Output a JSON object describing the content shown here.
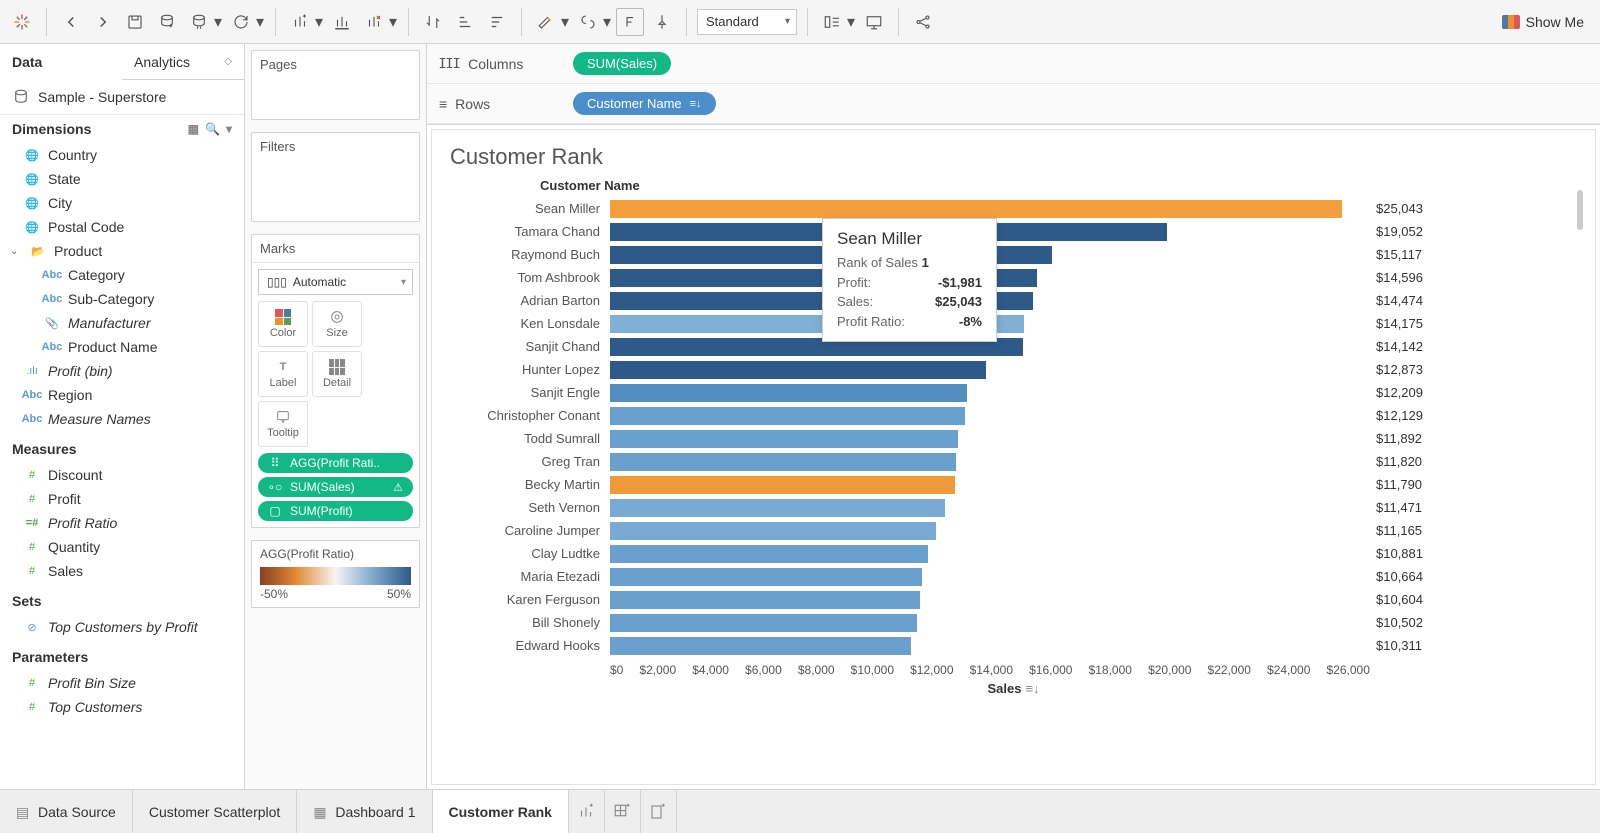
{
  "toolbar": {
    "fit_mode": "Standard",
    "show_me": "Show Me"
  },
  "side_tabs": {
    "data": "Data",
    "analytics": "Analytics"
  },
  "datasource": "Sample - Superstore",
  "sections": {
    "dimensions": "Dimensions",
    "measures": "Measures",
    "sets": "Sets",
    "parameters": "Parameters"
  },
  "dims": {
    "country": "Country",
    "state": "State",
    "city": "City",
    "postal": "Postal Code",
    "product": "Product",
    "category": "Category",
    "subcat": "Sub-Category",
    "manufacturer": "Manufacturer",
    "prodname": "Product Name",
    "profitbin": "Profit (bin)",
    "region": "Region",
    "measurenames": "Measure Names"
  },
  "meas": {
    "discount": "Discount",
    "profit": "Profit",
    "profitratio": "Profit Ratio",
    "quantity": "Quantity",
    "sales": "Sales"
  },
  "sets": {
    "topcust": "Top Customers by Profit"
  },
  "params": {
    "profitbinsize": "Profit Bin Size",
    "topcustomers": "Top Customers"
  },
  "shelves": {
    "pages": "Pages",
    "filters": "Filters",
    "marks": "Marks",
    "mark_type": "Automatic",
    "color": "Color",
    "size": "Size",
    "label": "Label",
    "detail": "Detail",
    "tooltip": "Tooltip",
    "pills": {
      "agg_profit_ratio": "AGG(Profit Rati..",
      "sum_sales": "SUM(Sales)",
      "sum_profit": "SUM(Profit)"
    }
  },
  "legend": {
    "title": "AGG(Profit Ratio)",
    "min": "-50%",
    "max": "50%"
  },
  "rc": {
    "columns": "Columns",
    "rows": "Rows",
    "col_pill": "SUM(Sales)",
    "row_pill": "Customer Name"
  },
  "viz": {
    "title": "Customer Rank",
    "field_header": "Customer Name",
    "axis_title": "Sales"
  },
  "chart_data": {
    "type": "bar",
    "xlabel": "Sales",
    "ylabel": "Customer Name",
    "xticks": [
      "$0",
      "$2,000",
      "$4,000",
      "$6,000",
      "$8,000",
      "$10,000",
      "$12,000",
      "$14,000",
      "$16,000",
      "$18,000",
      "$20,000",
      "$22,000",
      "$24,000",
      "$26,000"
    ],
    "xmax": 26000,
    "series": [
      {
        "name": "Sean Miller",
        "value": 25043,
        "label": "$25,043",
        "color": "#f3a03c"
      },
      {
        "name": "Tamara Chand",
        "value": 19052,
        "label": "$19,052",
        "color": "#2e5a8a"
      },
      {
        "name": "Raymond Buch",
        "value": 15117,
        "label": "$15,117",
        "color": "#2e5a8a"
      },
      {
        "name": "Tom Ashbrook",
        "value": 14596,
        "label": "$14,596",
        "color": "#2e5a8a"
      },
      {
        "name": "Adrian Barton",
        "value": 14474,
        "label": "$14,474",
        "color": "#2e5a8a"
      },
      {
        "name": "Ken Lonsdale",
        "value": 14175,
        "label": "$14,175",
        "color": "#82afd6"
      },
      {
        "name": "Sanjit Chand",
        "value": 14142,
        "label": "$14,142",
        "color": "#2e5a8a"
      },
      {
        "name": "Hunter Lopez",
        "value": 12873,
        "label": "$12,873",
        "color": "#2e5a8a"
      },
      {
        "name": "Sanjit Engle",
        "value": 12209,
        "label": "$12,209",
        "color": "#538ec0"
      },
      {
        "name": "Christopher Conant",
        "value": 12129,
        "label": "$12,129",
        "color": "#6aa0cd"
      },
      {
        "name": "Todd Sumrall",
        "value": 11892,
        "label": "$11,892",
        "color": "#6aa0cd"
      },
      {
        "name": "Greg Tran",
        "value": 11820,
        "label": "$11,820",
        "color": "#6aa0cd"
      },
      {
        "name": "Becky Martin",
        "value": 11790,
        "label": "$11,790",
        "color": "#ee9a3a"
      },
      {
        "name": "Seth Vernon",
        "value": 11471,
        "label": "$11,471",
        "color": "#79aad3"
      },
      {
        "name": "Caroline Jumper",
        "value": 11165,
        "label": "$11,165",
        "color": "#79aad3"
      },
      {
        "name": "Clay Ludtke",
        "value": 10881,
        "label": "$10,881",
        "color": "#6aa0cd"
      },
      {
        "name": "Maria Etezadi",
        "value": 10664,
        "label": "$10,664",
        "color": "#6aa0cd"
      },
      {
        "name": "Karen Ferguson",
        "value": 10604,
        "label": "$10,604",
        "color": "#6aa0cd"
      },
      {
        "name": "Bill Shonely",
        "value": 10502,
        "label": "$10,502",
        "color": "#6aa0cd"
      },
      {
        "name": "Edward Hooks",
        "value": 10311,
        "label": "$10,311",
        "color": "#6aa0cd"
      }
    ]
  },
  "tooltip": {
    "name": "Sean Miller",
    "rank_label": "Rank of Sales",
    "rank_value": "1",
    "profit_label": "Profit:",
    "profit_value": "-$1,981",
    "sales_label": "Sales:",
    "sales_value": "$25,043",
    "pr_label": "Profit Ratio:",
    "pr_value": "-8%"
  },
  "bottom": {
    "datasource": "Data Source",
    "tab1": "Customer Scatterplot",
    "tab2": "Dashboard 1",
    "tab3": "Customer Rank"
  }
}
